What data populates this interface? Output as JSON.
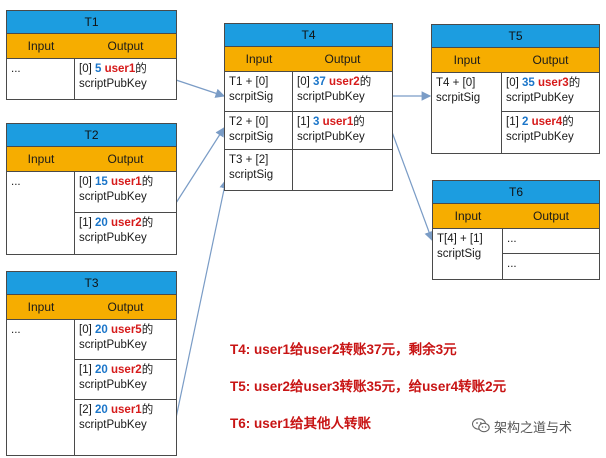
{
  "colors": {
    "header": "#1c9de0",
    "column_header": "#f6ad00",
    "number": "#1a75c9",
    "user": "#d61a1a",
    "note": "#c81414",
    "arrow": "#7a9cc6"
  },
  "labels": {
    "input": "Input",
    "output": "Output"
  },
  "transactions": {
    "t1": {
      "title": "T1",
      "inputs": [
        "..."
      ],
      "outputs": [
        {
          "idx": "[0]",
          "amount": "5",
          "user": "user1",
          "suffix": "的",
          "line2": "scriptPubKey"
        }
      ]
    },
    "t2": {
      "title": "T2",
      "inputs": [
        "..."
      ],
      "outputs": [
        {
          "idx": "[0]",
          "amount": "15",
          "user": "user1",
          "suffix": "的",
          "line2": "scriptPubKey"
        },
        {
          "idx": "[1]",
          "amount": "20",
          "user": "user2",
          "suffix": "的",
          "line2": "scriptPubKey"
        }
      ]
    },
    "t3": {
      "title": "T3",
      "inputs": [
        "..."
      ],
      "outputs": [
        {
          "idx": "[0]",
          "amount": "20",
          "user": "user5",
          "suffix": "的",
          "line2": "scriptPubKey"
        },
        {
          "idx": "[1]",
          "amount": "20",
          "user": "user2",
          "suffix": "的",
          "line2": "scriptPubKey"
        },
        {
          "idx": "[2]",
          "amount": "20",
          "user": "user1",
          "suffix": "的",
          "line2": "scriptPubKey"
        }
      ]
    },
    "t4": {
      "title": "T4",
      "inputs": [
        {
          "line1": "T1 + [0]",
          "line2": "scrpitSig"
        },
        {
          "line1": "T2 + [0]",
          "line2": "scrpitSig"
        },
        {
          "line1": "T3 + [2]",
          "line2": "scriptSig"
        }
      ],
      "outputs": [
        {
          "idx": "[0]",
          "amount": "37",
          "user": "user2",
          "suffix": "的",
          "line2": "scriptPubKey"
        },
        {
          "idx": "[1]",
          "amount": "3",
          "user": "user1",
          "suffix": "的",
          "line2": "scriptPubKey"
        }
      ]
    },
    "t5": {
      "title": "T5",
      "inputs": [
        {
          "line1": "T4 + [0]",
          "line2": "scrpitSig"
        }
      ],
      "outputs": [
        {
          "idx": "[0]",
          "amount": "35",
          "user": "user3",
          "suffix": "的",
          "line2": "scriptPubKey"
        },
        {
          "idx": "[1]",
          "amount": "2",
          "user": "user4",
          "suffix": "的",
          "line2": "scriptPubKey"
        }
      ]
    },
    "t6": {
      "title": "T6",
      "inputs": [
        {
          "line1": "T[4] + [1]",
          "line2": "scriptSig"
        }
      ],
      "outputs": [
        "...",
        "..."
      ]
    }
  },
  "notes": [
    "T4: user1给user2转账37元，剩余3元",
    "T5: user2给user3转账35元，给user4转账2元",
    "T6: user1给其他人转账"
  ],
  "watermark": {
    "icon": "wechat-icon",
    "text": "架构之道与术"
  }
}
